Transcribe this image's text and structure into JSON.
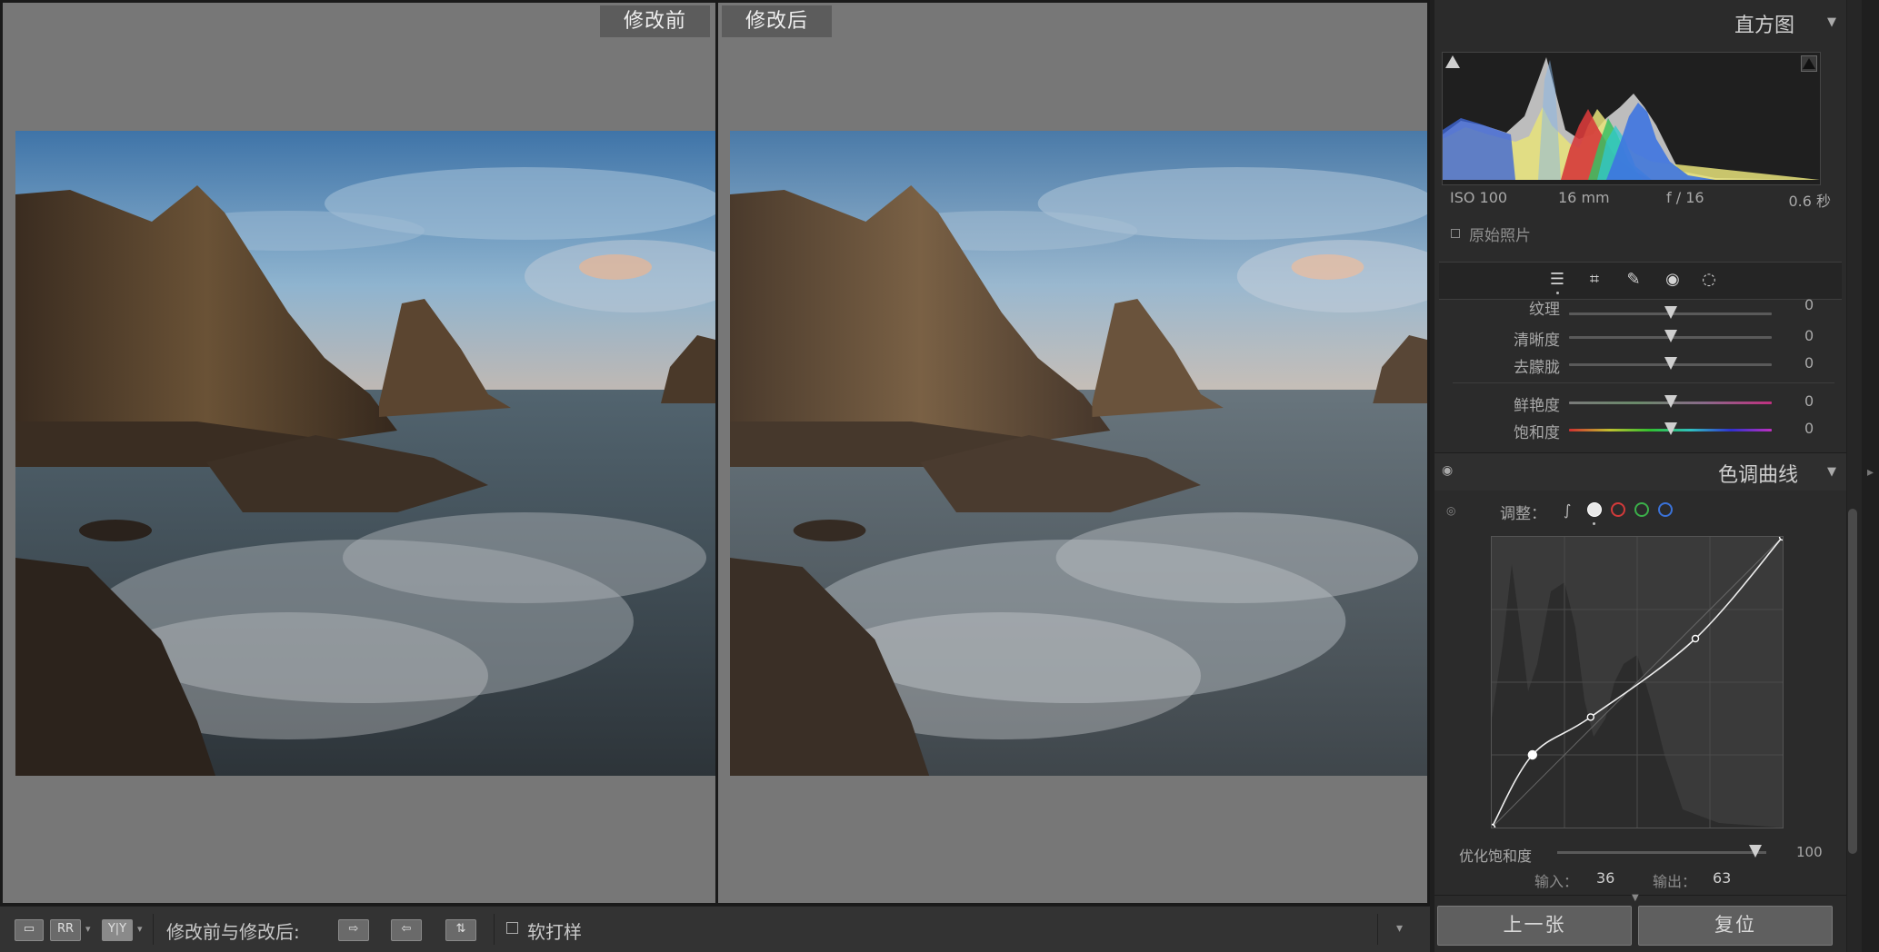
{
  "compare": {
    "before_label": "修改前",
    "after_label": "修改后"
  },
  "toolbar": {
    "view_mode_label": "修改前与修改后:",
    "view_btn_1": "▭",
    "view_btn_2": "RR",
    "view_btn_3": "Y|Y",
    "swap_btn_1": "⇨",
    "swap_btn_2": "⇦",
    "swap_btn_3": "⇅",
    "softproof_label": "软打样",
    "dropdown_icon": "▾"
  },
  "histogram": {
    "title": "直方图",
    "iso": "ISO 100",
    "focal": "16 mm",
    "aperture": "f / 16",
    "shutter": "0.6 秒",
    "original_photo_label": "原始照片"
  },
  "tools": {
    "icons": [
      "sliders-icon",
      "crop-icon",
      "healing-icon",
      "red-eye-icon",
      "mask-icon"
    ]
  },
  "sliders": [
    {
      "label": "纹理",
      "value": "0",
      "position_pct": 50
    },
    {
      "label": "清晰度",
      "value": "0",
      "position_pct": 50
    },
    {
      "label": "去朦胧",
      "value": "0",
      "position_pct": 50
    },
    {
      "label": "鲜艳度",
      "value": "0",
      "position_pct": 50
    },
    {
      "label": "饱和度",
      "value": "0",
      "position_pct": 50
    }
  ],
  "tone_curve": {
    "title": "色调曲线",
    "adjust_label": "调整：",
    "channels": [
      "parametric",
      "rgb",
      "red",
      "green",
      "blue"
    ],
    "channel_colors": [
      "#bbbbbb",
      "#e8e8e8",
      "#d23a3a",
      "#3bb04a",
      "#3a72d8"
    ],
    "points": [
      [
        0,
        0
      ],
      [
        14,
        25
      ],
      [
        34,
        38
      ],
      [
        70,
        65
      ],
      [
        100,
        100
      ]
    ],
    "refine_saturation_label": "优化饱和度",
    "refine_saturation_value": "100",
    "refine_saturation_pct": 100,
    "input_label": "输入：",
    "input_value": "36",
    "output_label": "输出：",
    "output_value": "63"
  },
  "buttons": {
    "prev": "上一张",
    "reset": "复位"
  },
  "colors": {
    "panel_bg": "#2b2b2b",
    "pane_bg": "#777777"
  }
}
